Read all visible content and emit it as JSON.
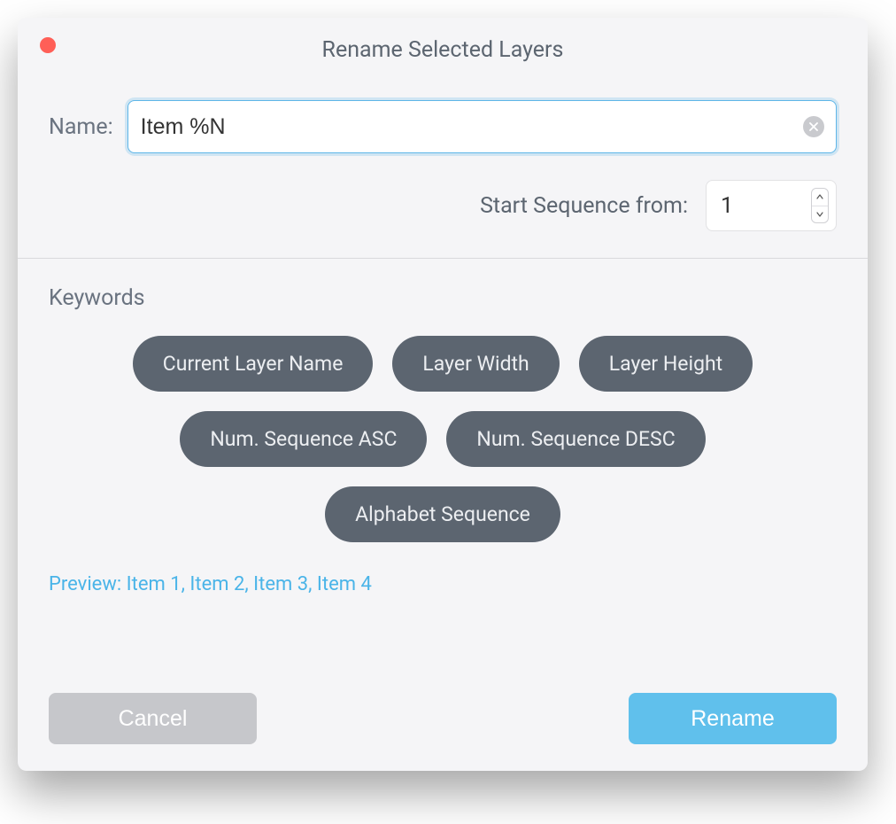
{
  "title": "Rename Selected Layers",
  "form": {
    "name_label": "Name:",
    "name_value": "Item %N",
    "sequence_label": "Start Sequence from:",
    "sequence_value": "1"
  },
  "keywords": {
    "title": "Keywords",
    "pills": [
      "Current Layer Name",
      "Layer Width",
      "Layer Height",
      "Num. Sequence ASC",
      "Num. Sequence DESC",
      "Alphabet Sequence"
    ]
  },
  "preview": "Preview: Item 1, Item 2, Item 3, Item 4",
  "buttons": {
    "cancel": "Cancel",
    "rename": "Rename"
  }
}
